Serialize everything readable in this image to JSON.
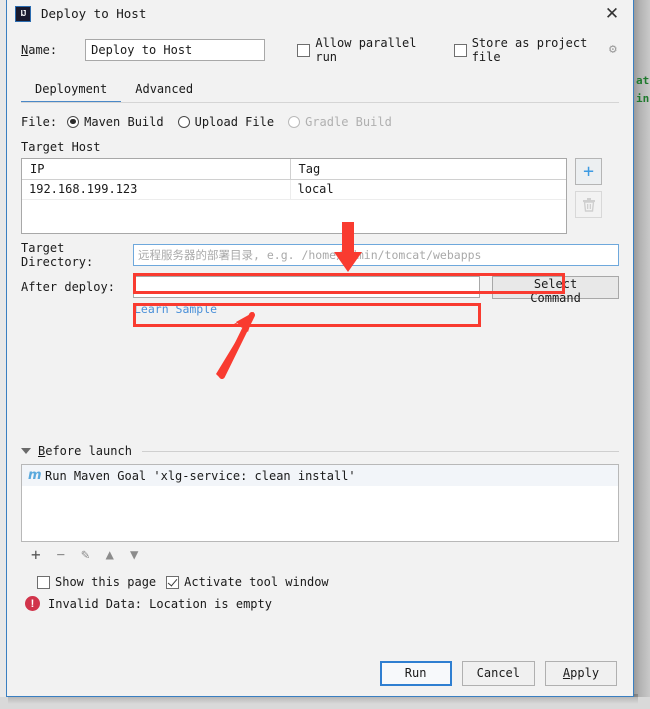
{
  "window": {
    "title": "Deploy to Host",
    "app_icon": "IJ",
    "close_icon": "✕"
  },
  "name_row": {
    "label": "Name:",
    "value": "Deploy to Host",
    "allow_parallel_run": {
      "label": "Allow parallel run",
      "checked": false
    },
    "store_as_project_file": {
      "label": "Store as project file",
      "checked": false
    },
    "gear_icon": "gear-icon"
  },
  "tabs": [
    {
      "label": "Deployment",
      "active": true
    },
    {
      "label": "Advanced",
      "active": false
    }
  ],
  "file_row": {
    "label": "File:",
    "options": [
      {
        "label": "Maven Build",
        "selected": true,
        "disabled": false
      },
      {
        "label": "Upload File",
        "selected": false,
        "disabled": false
      },
      {
        "label": "Gradle Build",
        "selected": false,
        "disabled": true
      }
    ]
  },
  "target_host": {
    "label": "Target Host",
    "columns": [
      "IP",
      "Tag"
    ],
    "rows": [
      {
        "ip": "192.168.199.123",
        "tag": "local"
      }
    ],
    "add_button": "+",
    "delete_button": "trash-icon"
  },
  "target_directory": {
    "label": "Target Directory:",
    "value": "",
    "placeholder": "远程服务器的部署目录, e.g. /home/admin/tomcat/webapps"
  },
  "after_deploy": {
    "label": "After deploy:",
    "value": "",
    "placeholder": "",
    "select_command_button": "Select Command",
    "learn_sample_link": "Learn Sample"
  },
  "before_launch": {
    "title": "Before launch",
    "expanded": true,
    "items": [
      {
        "icon": "maven-icon",
        "text": "Run Maven Goal 'xlg-service: clean install'"
      }
    ],
    "toolbar": [
      "+",
      "−",
      "✎",
      "▲",
      "▼"
    ]
  },
  "options": {
    "show_this_page": {
      "label": "Show this page",
      "checked": false
    },
    "activate_tool_window": {
      "label": "Activate tool window",
      "checked": true
    }
  },
  "status": {
    "icon": "error-icon",
    "message": "Invalid Data: Location is empty"
  },
  "footer_buttons": [
    {
      "label": "Run",
      "default": true
    },
    {
      "label": "Cancel",
      "default": false
    },
    {
      "label": "Apply",
      "default": false
    }
  ],
  "background": {
    "code_fragment_1": "at",
    "code_fragment_2": "in"
  },
  "annotations": {
    "accent_color": "#f93b30",
    "highlight_target_directory": true,
    "highlight_after_deploy": true
  }
}
